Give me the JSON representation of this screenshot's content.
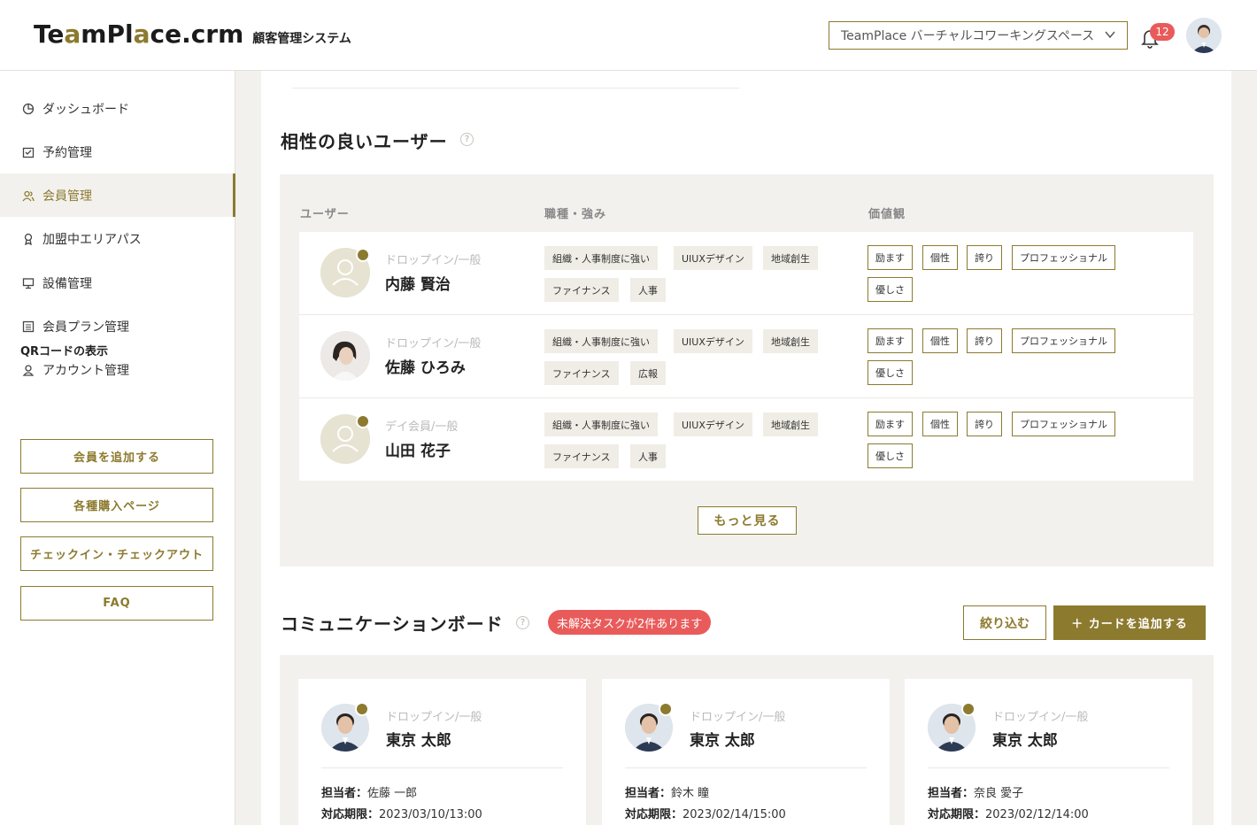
{
  "header": {
    "logo_prefix": "Te",
    "logo_a1": "a",
    "logo_mid": "mPl",
    "logo_a2": "a",
    "logo_suffix": "ce.crm",
    "logo_sub": "顧客管理システム",
    "workspace": "TeamPlace バーチャルコワーキングスペース",
    "notification_count": "12"
  },
  "sidebar": {
    "items": [
      {
        "label": "ダッシュボード",
        "icon": "pie-chart-icon"
      },
      {
        "label": "予約管理",
        "icon": "calendar-check-icon"
      },
      {
        "label": "会員管理",
        "icon": "users-icon"
      },
      {
        "label": "加盟中エリアパス",
        "icon": "award-icon"
      },
      {
        "label": "設備管理",
        "icon": "monitor-icon"
      },
      {
        "label": "会員プラン管理",
        "icon": "list-icon"
      },
      {
        "label": "アカウント管理",
        "icon": "account-icon"
      }
    ],
    "qr_heading": "QRコードの表示",
    "buttons": [
      "会員を追加する",
      "各種購入ページ",
      "チェックイン・チェックアウト",
      "FAQ"
    ]
  },
  "compat": {
    "title": "相性の良いユーザー",
    "col_user": "ユーザー",
    "col_skills": "職種・強み",
    "col_values": "価値観",
    "users": [
      {
        "role": "ドロップイン/一般",
        "name": "内藤 賢治",
        "skills_row1": [
          "組織・人事制度に強い",
          "UIUXデザイン",
          "地域創生"
        ],
        "skills_row2": [
          "ファイナンス",
          "人事"
        ],
        "values_row1": [
          "励ます",
          "個性",
          "誇り",
          "プロフェッショナル"
        ],
        "values_row2": [
          "優しさ"
        ]
      },
      {
        "role": "ドロップイン/一般",
        "name": "佐藤 ひろみ",
        "skills_row1": [
          "組織・人事制度に強い",
          "UIUXデザイン",
          "地域創生"
        ],
        "skills_row2": [
          "ファイナンス",
          "広報"
        ],
        "values_row1": [
          "励ます",
          "個性",
          "誇り",
          "プロフェッショナル"
        ],
        "values_row2": [
          "優しさ"
        ]
      },
      {
        "role": "デイ会員/一般",
        "name": "山田 花子",
        "skills_row1": [
          "組織・人事制度に強い",
          "UIUXデザイン",
          "地域創生"
        ],
        "skills_row2": [
          "ファイナンス",
          "人事"
        ],
        "values_row1": [
          "励ます",
          "個性",
          "誇り",
          "プロフェッショナル"
        ],
        "values_row2": [
          "優しさ"
        ]
      }
    ],
    "more_label": "もっと見る"
  },
  "board": {
    "title": "コミュニケーションボード",
    "alert": "未解決タスクが2件あります",
    "filter_label": "絞り込む",
    "add_card_label": "＋ カードを追加する",
    "assignee_label": "担当者：",
    "deadline_label": "対応期限：",
    "cards": [
      {
        "role": "ドロップイン/一般",
        "name": "東京 太郎",
        "assignee": "佐藤 一郎",
        "deadline": "2023/03/10/13:00"
      },
      {
        "role": "ドロップイン/一般",
        "name": "東京 太郎",
        "assignee": "鈴木 瞳",
        "deadline": "2023/02/14/15:00"
      },
      {
        "role": "ドロップイン/一般",
        "name": "東京 太郎",
        "assignee": "奈良 愛子",
        "deadline": "2023/02/12/14:00"
      }
    ]
  },
  "colors": {
    "accent": "#8c7a2e",
    "alert": "#e95b5b",
    "panel": "#f3f1ee"
  }
}
